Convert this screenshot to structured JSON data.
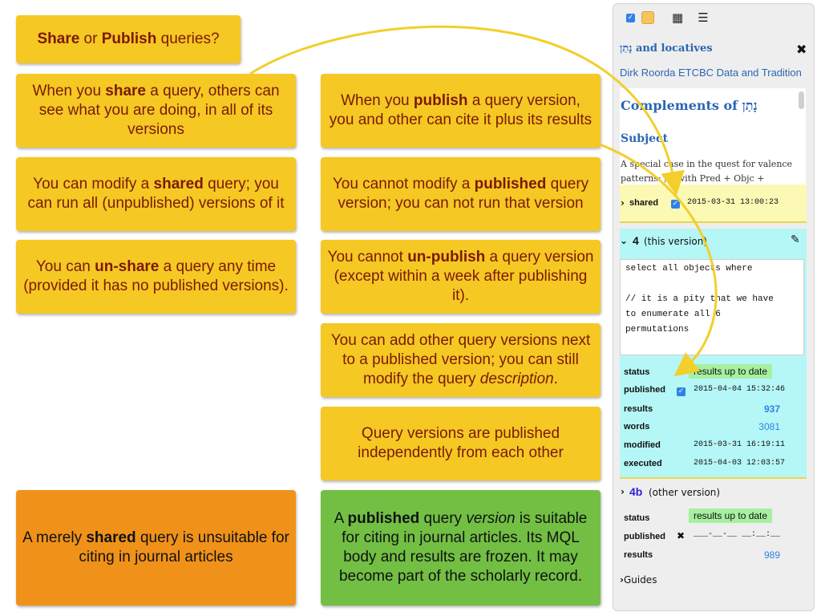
{
  "cards": {
    "title": {
      "strong1": "Share",
      "mid": " or ",
      "strong2": "Publish",
      "tail": " queries?"
    },
    "share_cite": {
      "pre": "When you ",
      "strong": "share",
      "post": " a query, others can see what you are doing, in all of its versions"
    },
    "share_modify": {
      "pre": "You can modify a ",
      "strong": "shared",
      "post": " query; you can run all (unpublished) versions of it"
    },
    "share_unshare": {
      "pre": "You can ",
      "strong": "un-share",
      "post": " a query any time (provided it has no published versions)."
    },
    "publish_cite": {
      "pre": "When you ",
      "strong": "publish",
      "post": " a query version, you and other can cite it plus its results"
    },
    "publish_modify": {
      "pre": "You cannot modify a ",
      "strong": "published",
      "post": " query version; you can not run that version"
    },
    "publish_unpublish": {
      "pre": "You cannot ",
      "strong": "un-publish",
      "post": " a query version (except within a week after publishing it)."
    },
    "publish_add": {
      "pre": "You can add other query versions next to a published version; you can still modify the query ",
      "em": "description",
      "post": "."
    },
    "independent": {
      "text": "Query versions are published independently from each other"
    },
    "merely_shared": {
      "pre": "A merely ",
      "strong": "shared",
      "post": " query is unsuitable for citing in journal articles"
    },
    "published_version": {
      "pre": "A ",
      "strong": "published",
      "mid": " query ",
      "em": "version",
      "post": " is suitable for citing in journal articles. Its MQL body and results are frozen. It may become part of the scholarly record."
    }
  },
  "panel": {
    "toolbar_icons": [
      "checkbox-icon",
      "color-swatch-icon",
      "table-icon",
      "list-icon"
    ],
    "query_title": "נָתַן and locatives",
    "expand_icon": "✖",
    "author": "Dirk Roorda ETCBC Data and Tradition",
    "description": {
      "heading": "Complements of נָתַן",
      "subheading": "Subject",
      "paragraph": "A special case in the quest for valence patterns: נתן with Pred + Objc +"
    },
    "shared": {
      "label": "shared",
      "timestamp": "2015-03-31 13:00:23"
    },
    "this_version": {
      "name": "4",
      "note": "(this version)",
      "mql": "select all objects where\n\n// it is a pity that we have\nto enumerate all 6\npermutations\n\n"
    },
    "this_version_stats": {
      "status_label": "status",
      "status_value": "results up to date",
      "published_label": "published",
      "published_value": "2015-04-04 15:32:46",
      "results_label": "results",
      "results_value": "937",
      "words_label": "words",
      "words_value": "3081",
      "modified_label": "modified",
      "modified_value": "2015-03-31 16:19:11",
      "executed_label": "executed",
      "executed_value": "2015-04-03 12:03:57"
    },
    "other_version": {
      "name": "4b",
      "note": "(other version)"
    },
    "other_version_stats": {
      "status_label": "status",
      "status_value": "results up to date",
      "published_label": "published",
      "published_mark": "✖",
      "published_value": "___-__-__ __:__:__",
      "results_label": "results",
      "results_value": "989"
    },
    "guides_label": "Guides"
  },
  "colors": {
    "card_yellow": "#f5c823",
    "card_text": "#7a1a07",
    "card_orange": "#f0921a",
    "card_green": "#72bf44",
    "panel_bg": "#eeeeee",
    "link_blue": "#2b66b3",
    "shared_band": "#fbf9b4",
    "version_band": "#b5f6f6",
    "status_pill": "#a6f0a0",
    "arrow": "#f2cf2b"
  }
}
